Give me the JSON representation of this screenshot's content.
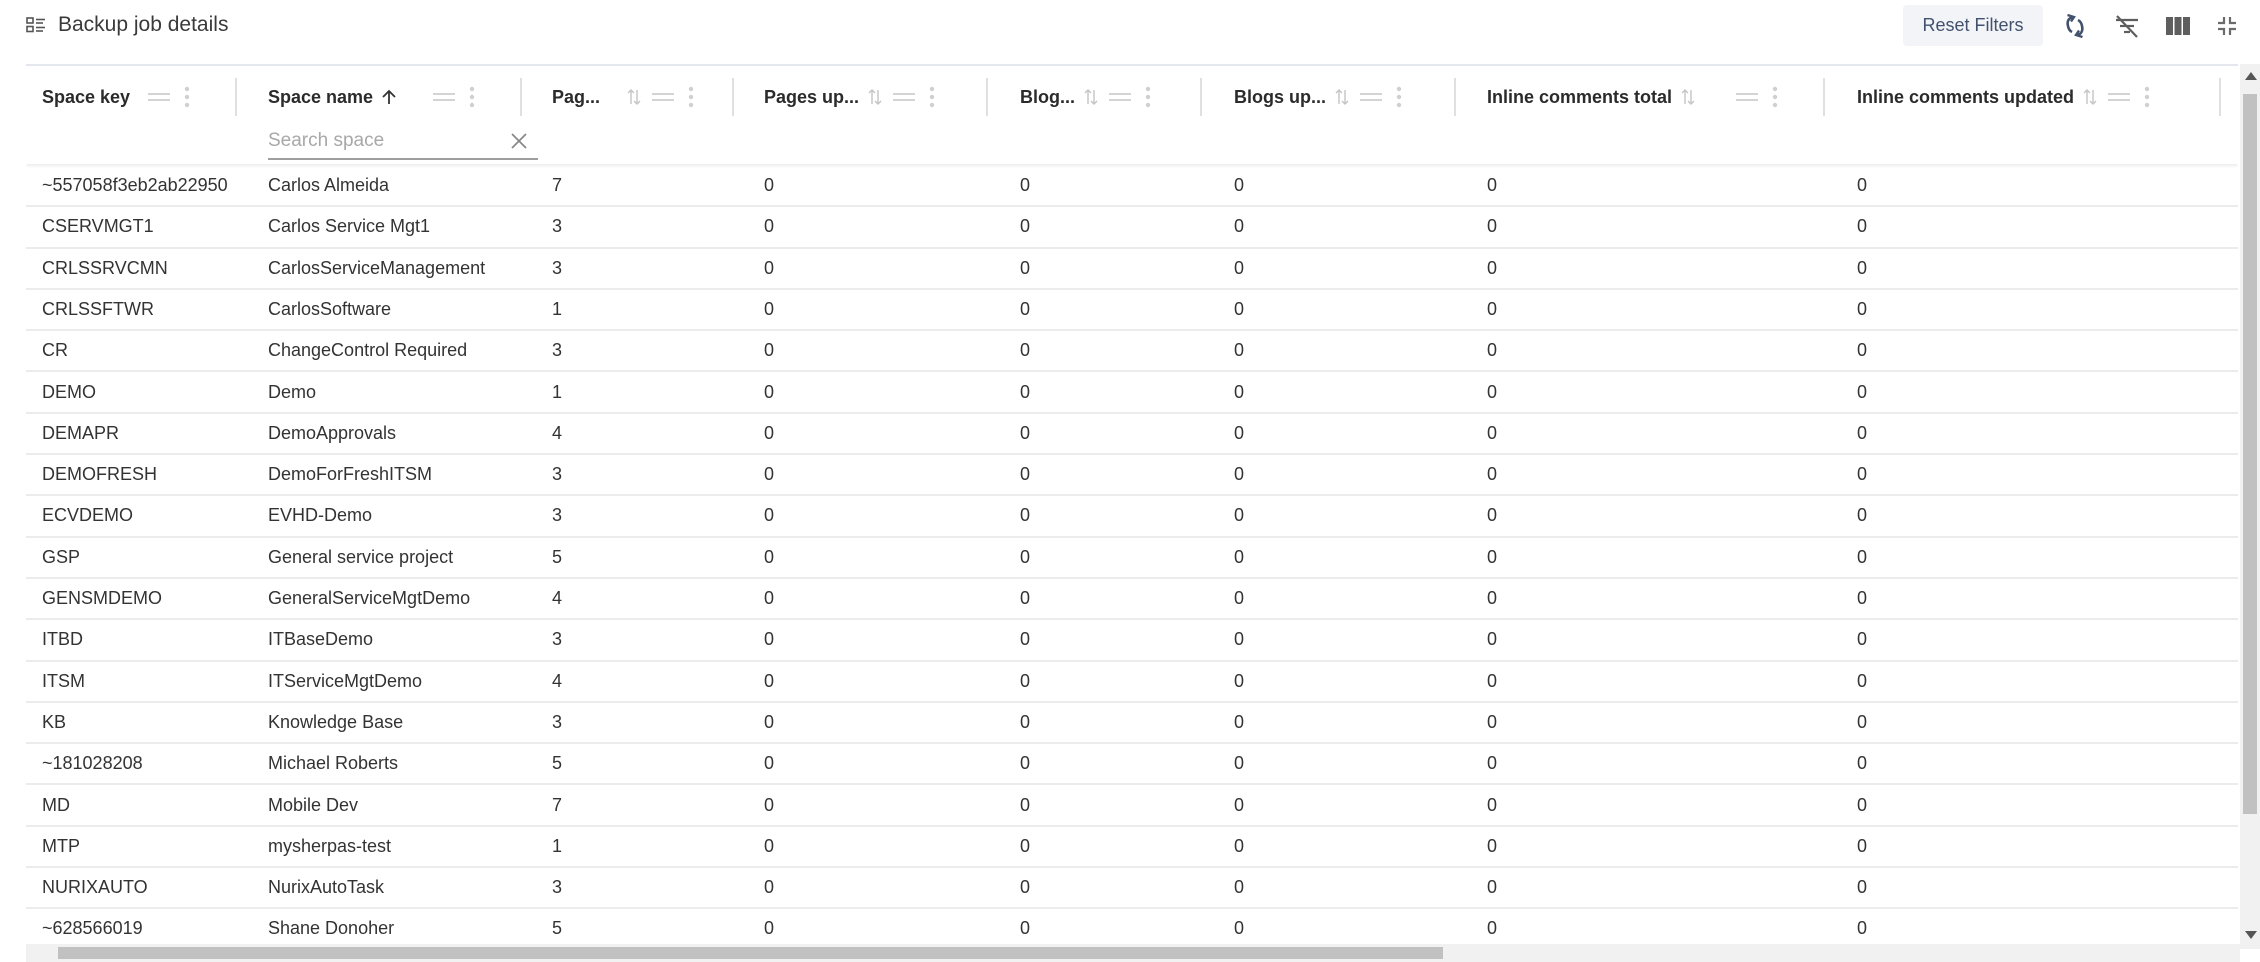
{
  "header": {
    "title": "Backup job details",
    "title_icon": "list-details-icon",
    "reset_filters_label": "Reset Filters",
    "toolbar_icons": [
      "refresh-icon",
      "clear-filter-icon",
      "columns-icon",
      "collapse-icon"
    ]
  },
  "columns": [
    {
      "label": "Space key",
      "sortable": false,
      "sort": "none"
    },
    {
      "label": "Space name",
      "sortable": true,
      "sort": "asc"
    },
    {
      "label": "Pag...",
      "sortable": true,
      "sort": "none"
    },
    {
      "label": "Pages up...",
      "sortable": true,
      "sort": "none"
    },
    {
      "label": "Blog...",
      "sortable": true,
      "sort": "none"
    },
    {
      "label": "Blogs up...",
      "sortable": true,
      "sort": "none"
    },
    {
      "label": "Inline comments total",
      "sortable": true,
      "sort": "none"
    },
    {
      "label": "Inline comments updated",
      "sortable": true,
      "sort": "none"
    }
  ],
  "search": {
    "placeholder": "Search space",
    "value": ""
  },
  "rows": [
    [
      "~557058f3eb2ab22950",
      "Carlos Almeida",
      "7",
      "0",
      "0",
      "0",
      "0",
      "0"
    ],
    [
      "CSERVMGT1",
      "Carlos Service Mgt1",
      "3",
      "0",
      "0",
      "0",
      "0",
      "0"
    ],
    [
      "CRLSSRVCMN",
      "CarlosServiceManagement",
      "3",
      "0",
      "0",
      "0",
      "0",
      "0"
    ],
    [
      "CRLSSFTWR",
      "CarlosSoftware",
      "1",
      "0",
      "0",
      "0",
      "0",
      "0"
    ],
    [
      "CR",
      "ChangeControl Required",
      "3",
      "0",
      "0",
      "0",
      "0",
      "0"
    ],
    [
      "DEMO",
      "Demo",
      "1",
      "0",
      "0",
      "0",
      "0",
      "0"
    ],
    [
      "DEMAPR",
      "DemoApprovals",
      "4",
      "0",
      "0",
      "0",
      "0",
      "0"
    ],
    [
      "DEMOFRESH",
      "DemoForFreshITSM",
      "3",
      "0",
      "0",
      "0",
      "0",
      "0"
    ],
    [
      "ECVDEMO",
      "EVHD-Demo",
      "3",
      "0",
      "0",
      "0",
      "0",
      "0"
    ],
    [
      "GSP",
      "General service project",
      "5",
      "0",
      "0",
      "0",
      "0",
      "0"
    ],
    [
      "GENSMDEMO",
      "GeneralServiceMgtDemo",
      "4",
      "0",
      "0",
      "0",
      "0",
      "0"
    ],
    [
      "ITBD",
      "ITBaseDemo",
      "3",
      "0",
      "0",
      "0",
      "0",
      "0"
    ],
    [
      "ITSM",
      "ITServiceMgtDemo",
      "4",
      "0",
      "0",
      "0",
      "0",
      "0"
    ],
    [
      "KB",
      "Knowledge Base",
      "3",
      "0",
      "0",
      "0",
      "0",
      "0"
    ],
    [
      "~181028208",
      "Michael Roberts",
      "5",
      "0",
      "0",
      "0",
      "0",
      "0"
    ],
    [
      "MD",
      "Mobile Dev",
      "7",
      "0",
      "0",
      "0",
      "0",
      "0"
    ],
    [
      "MTP",
      "mysherpas-test",
      "1",
      "0",
      "0",
      "0",
      "0",
      "0"
    ],
    [
      "NURIXAUTO",
      "NurixAutoTask",
      "3",
      "0",
      "0",
      "0",
      "0",
      "0"
    ],
    [
      "~628566019",
      "Shane Donoher",
      "5",
      "0",
      "0",
      "0",
      "0",
      "0"
    ]
  ],
  "colors": {
    "header_text": "#2b2b2b",
    "cell_text": "#333333",
    "reset_button_bg": "#f2f4f7",
    "reset_button_text": "#42526e",
    "icon_color": "#42526e",
    "scrollbar_thumb": "#c1c1c1"
  }
}
